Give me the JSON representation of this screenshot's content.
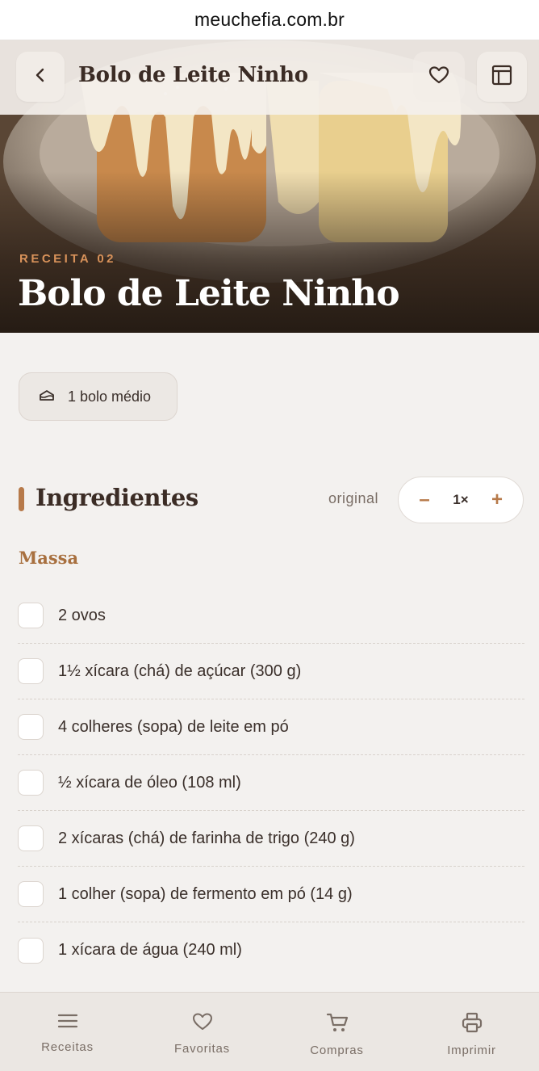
{
  "browser": {
    "url": "meuchefia.com.br"
  },
  "header": {
    "title": "Bolo de Leite Ninho",
    "back_icon": "chevron-left-icon",
    "favorite_icon": "heart-icon",
    "layout_icon": "layout-panel-icon"
  },
  "hero": {
    "kicker": "RECEITA 02",
    "title": "Bolo de Leite Ninho"
  },
  "yield": {
    "icon": "cake-icon",
    "label": "1 bolo médio"
  },
  "ingredients": {
    "title": "Ingredientes",
    "scale_label": "original",
    "stepper": {
      "minus": "–",
      "value": "1×",
      "plus": "+"
    },
    "group": "Massa",
    "items": [
      "2 ovos",
      "1½ xícara (chá) de açúcar (300 g)",
      "4 colheres (sopa) de leite em pó",
      "½ xícara de óleo (108 ml)",
      "2 xícaras (chá) de farinha de trigo (240 g)",
      "1 colher (sopa) de fermento em pó (14 g)",
      "1 xícara de água (240 ml)"
    ]
  },
  "bottom_nav": [
    {
      "label": "Receitas",
      "icon": "menu-icon"
    },
    {
      "label": "Favoritas",
      "icon": "heart-icon"
    },
    {
      "label": "Compras",
      "icon": "cart-icon"
    },
    {
      "label": "Imprimir",
      "icon": "printer-icon"
    }
  ],
  "colors": {
    "accent": "#b77a4a",
    "kicker": "#d8925a",
    "background": "#f3f1ef"
  }
}
